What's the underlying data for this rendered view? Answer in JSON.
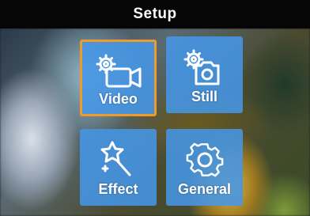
{
  "header": {
    "title": "Setup"
  },
  "menu": {
    "items": [
      {
        "label": "Video",
        "icon": "video-settings-icon",
        "selected": true
      },
      {
        "label": "Still",
        "icon": "camera-settings-icon",
        "selected": false
      },
      {
        "label": "Effect",
        "icon": "magic-wand-icon",
        "selected": false
      },
      {
        "label": "General",
        "icon": "gear-icon",
        "selected": false
      }
    ]
  },
  "colors": {
    "tile": "#4696E6",
    "selection": "#F09A2C",
    "titlebar": "#060606"
  }
}
